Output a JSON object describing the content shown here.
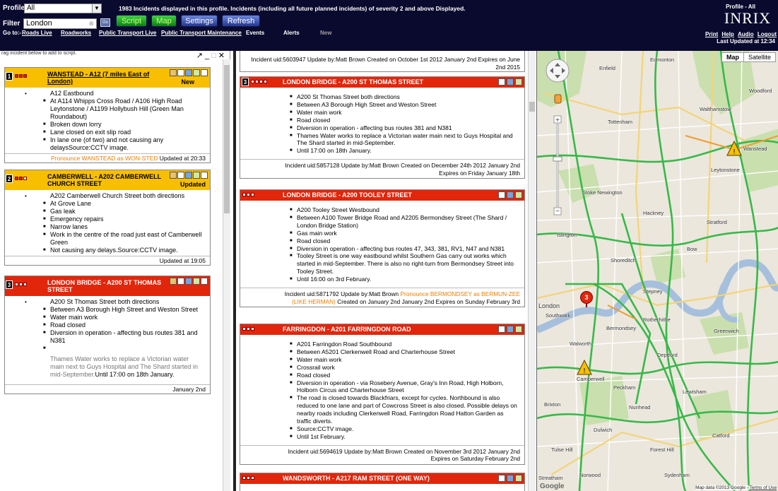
{
  "header": {
    "profile_label": "Profile",
    "profile_value": "All",
    "info": "1983 Incidents displayed in this profile. Incidents (including all future planned incidents) of severity 2 and above Displayed.",
    "filter_label": "Filter",
    "filter_value": "London",
    "go_label": "Go",
    "buttons": {
      "script": "Script",
      "map": "Map",
      "settings": "Settings",
      "refresh": "Refresh"
    },
    "goto_label": "Go to:-",
    "nav": [
      "Roads Live",
      "Roadworks",
      "Public Transport Live",
      "Public Transport Maintenance",
      "Events",
      "Alerts",
      "New"
    ],
    "profile_all": "Profile - All",
    "logo": "INRIX",
    "right_links": [
      "Print",
      "Help",
      "Audio",
      "Logout"
    ],
    "last_updated": "Last Updated at 12:34"
  },
  "left": {
    "hint": "rag incident below to add to script.",
    "cards": [
      {
        "sev": "1",
        "title": "WANSTEAD - A12 (7 miles East of London)",
        "status": "New",
        "main": "A12 Eastbound",
        "items": [
          "At A114 Whipps Cross Road / A106 High Road Leytonstone / A1199 Hollybush Hill (Green Man Roundabout)",
          "Broken down lorry",
          "Lane closed on exit slip road",
          "In lane one (of two) and not causing any delaysSource:CCTV image."
        ],
        "pronounce": "Pronounce WANSTEAD as WON-STED",
        "updated": "Updated at 20:33"
      },
      {
        "sev": "2",
        "title": "CAMBERWELL - A202 CAMBERWELL CHURCH STREET",
        "status": "Updated",
        "main": "A202 Camberwell Church Street both directions",
        "items": [
          "At Grove Lane",
          "Gas leak",
          "Emergency repairs",
          "Narrow lanes",
          "Work in the centre of the road just east of Camberwell Green",
          "Not causing any delays.Source:CCTV image."
        ],
        "updated": "Updated at 19:05"
      },
      {
        "sev": "3",
        "title": "LONDON BRIDGE - A200 ST THOMAS STREET",
        "main": "A200 St Thomas Street both directions",
        "items": [
          "Between A3 Borough High Street and Weston Street",
          "Water main work",
          "Road closed",
          "Diversion in operation - affecting bus routes 381 and N381"
        ],
        "desc": "Thames Water works to replace a Victorian water main next to Guys Hospital and The Shard started in mid-September.",
        "desc_tail": "Until 17:00 on 18th January.",
        "updated": "January 2nd"
      }
    ]
  },
  "middle": {
    "top_fragment": "Incident uid:5603947 Update by:Matt Brown Created on October 1st 2012 January 2nd Expires on June 2nd 2015",
    "cards": [
      {
        "sev": "3",
        "title": "LONDON BRIDGE - A200 ST THOMAS STREET",
        "items": [
          "A200 St Thomas Street both directions",
          "Between A3 Borough High Street and Weston Street",
          "Water main work",
          "Road closed",
          "Diversion in operation - affecting bus routes 381 and N381",
          "Thames Water works to replace a Victorian water main next to Guys Hospital and The Shard started in mid-September.",
          "Until 17:00 on 18th January."
        ],
        "footer": "Incident uid:5857128 Update by:Matt Brown Created on December 24th 2012 January 2nd Expires on Friday January 18th"
      },
      {
        "title": "LONDON BRIDGE - A200 TOOLEY STREET",
        "items": [
          "A200 Tooley Street Westbound",
          "Between A100 Tower Bridge Road and A2205 Bermondsey Street (The Shard / London Bridge Station)",
          "Gas main work",
          "Road closed",
          "Diversion in operation - affecting bus routes 47, 343, 381, RV1, N47 and N381",
          "Tooley Street is one way eastbound whilst Southern Gas carry out works which started in mid-September. There is also no right-turn from Bermondsey Street into Tooley Street.",
          "Until 16:00 on 3rd February."
        ],
        "footer_a": "Incident uid:5871792 Update by:Matt Brown",
        "footer_pron": "Pronounce BERMONDSEY as BERMUN-ZEE (LIKE HERMAN)",
        "footer_b": "Created on January 2nd January 2nd Expires on Sunday February 3rd"
      },
      {
        "title": "FARRINGDON - A201 FARRINGDON ROAD",
        "items": [
          "A201 Farringdon Road Southbound",
          "Between A5201 Clerkenwell Road and Charterhouse Street",
          "Water main work",
          "Crossrail work",
          "Road closed",
          "Diversion in operation - via Rosebery Avenue, Gray's Inn Road, High Holborn, Holborn Circus and Charterhouse Street",
          "The road is closed towards Blackfriars, except for cycles. Northbound is also reduced to one lane and part of Cowcross Street is also closed. Possible delays on nearby roads including Clerkenwell Road, Farringdon Road Hatton Garden as traffic diverts.",
          "Source:CCTV image.",
          "Until 1st February."
        ],
        "footer": "Incident uid:5694619 Update by:Matt Brown Created on November 3rd 2012 January 2nd Expires on Saturday February 2nd"
      },
      {
        "title": "WANDSWORTH - A217 RAM STREET (ONE WAY)"
      }
    ]
  },
  "map": {
    "type_map": "Map",
    "type_satellite": "Satellite",
    "labels": [
      "Enfield",
      "Edmonton",
      "Woodford",
      "Wanstead",
      "Tottenham",
      "Walthamstow",
      "Leytonstone",
      "Stoke Newington",
      "Hackney",
      "Stratford",
      "Islington",
      "Shoreditch",
      "Bow",
      "Stepney",
      "London",
      "Bermondsey",
      "Rotherhithe",
      "Deptford",
      "Southwark",
      "Peckham",
      "Walworth",
      "Camberwell",
      "Brixton",
      "Dulwich",
      "Nunhead",
      "Lewisham",
      "Greenwich",
      "Forest Hill",
      "Sydenham",
      "Norwood",
      "Catford",
      "Tulse Hill",
      "Streatham"
    ],
    "marker_3": "3",
    "credit": "Map data ©2013 Google -",
    "terms": "Terms of Use",
    "google": "Google"
  }
}
